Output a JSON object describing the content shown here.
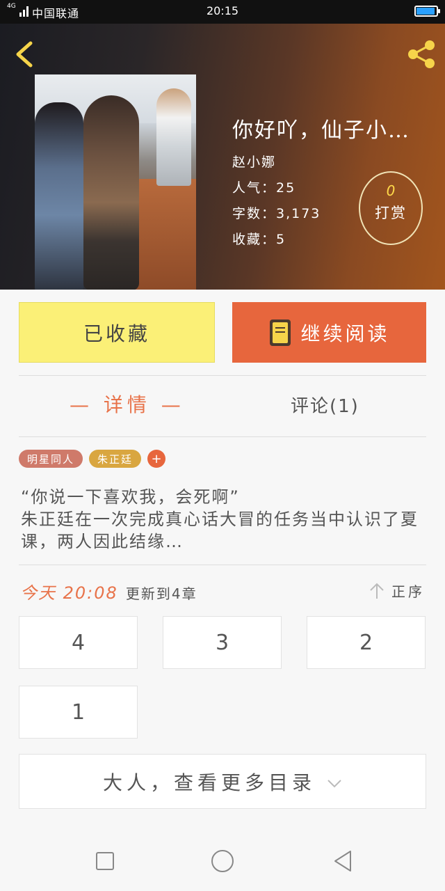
{
  "status_bar": {
    "signal_label": "4G",
    "carrier": "中国联通",
    "time": "20:15"
  },
  "header": {
    "title": "你好吖，仙子小…",
    "author": "赵小娜",
    "popularity": "人气：25",
    "word_count": "字数：3,173",
    "favorites": "收藏：5",
    "tip_count": "0",
    "tip_label": "打赏"
  },
  "actions": {
    "collected_label": "已收藏",
    "continue_label": "继续阅读"
  },
  "tabs": {
    "detail": "— 详情 —",
    "comments": "评论(1)"
  },
  "tags": [
    "明星同人",
    "朱正廷"
  ],
  "tag_add": "+",
  "synopsis": "“你说一下喜欢我，会死啊”\n朱正廷在一次完成真心话大冒的任务当中认识了夏课，两人因此结缘…",
  "update": {
    "time": "今天 20:08",
    "text": "更新到4章",
    "sort_label": "正序"
  },
  "chapters": [
    "4",
    "3",
    "2",
    "1"
  ],
  "more_label": "大人，查看更多目录",
  "colors": {
    "accent": "#e7663d",
    "collected_bg": "#fbf077",
    "tag_genre": "#cf7a6a",
    "tag_person": "#d9a640",
    "tip_count": "#ffd94a"
  },
  "icons": [
    "back-arrow-icon",
    "share-icon",
    "book-icon",
    "sort-up-arrow-icon",
    "chevron-down-icon",
    "nav-recent-icon",
    "nav-home-icon",
    "nav-back-icon"
  ]
}
